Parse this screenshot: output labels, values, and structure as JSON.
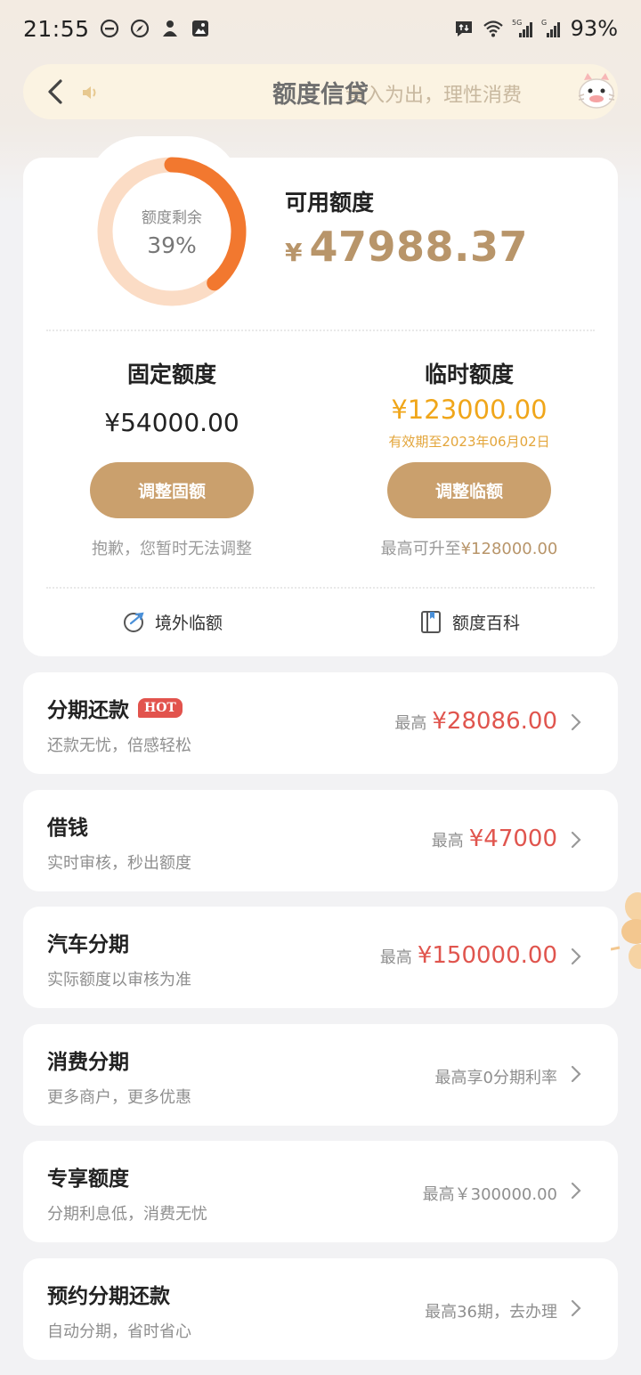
{
  "status_bar": {
    "time": "21:55",
    "battery": "93%",
    "left_icons": [
      "do-not-disturb-icon",
      "compass-icon",
      "app-icon",
      "image-icon"
    ],
    "right_icons": [
      "message-icon",
      "wifi-icon",
      "signal-5g-icon",
      "signal-g-icon"
    ]
  },
  "nav": {
    "title": "额度信贷",
    "marquee": "量入为出，理性消费",
    "back_icon": "back-arrow-icon",
    "speaker_icon": "speaker-icon",
    "mascot_icon": "mascot-icon"
  },
  "quota": {
    "ring_label": "额度剩余",
    "ring_percent_text": "39%",
    "ring_fraction": 0.39,
    "available_label": "可用额度",
    "available_currency": "¥",
    "available_amount": "47988.37",
    "fixed": {
      "title": "固定额度",
      "amount": "¥54000.00",
      "button": "调整固额",
      "note": "抱歉，您暂时无法调整"
    },
    "temp": {
      "title": "临时额度",
      "amount": "¥123000.00",
      "expiry": "有效期至2023年06月02日",
      "button": "调整临额",
      "note_prefix": "最高可升至",
      "note_value": "¥128000.00"
    },
    "links": {
      "overseas": "境外临额",
      "wiki": "额度百科"
    }
  },
  "products": [
    {
      "title": "分期还款",
      "badge": "HOT",
      "subtitle": "还款无忧，倍感轻松",
      "prefix": "最高",
      "value": "¥28086.00",
      "plain": ""
    },
    {
      "title": "借钱",
      "badge": "",
      "subtitle": "实时审核，秒出额度",
      "prefix": "最高",
      "value": "¥47000",
      "plain": ""
    },
    {
      "title": "汽车分期",
      "badge": "",
      "subtitle": "实际额度以审核为准",
      "prefix": "最高",
      "value": "¥150000.00",
      "plain": ""
    },
    {
      "title": "消费分期",
      "badge": "",
      "subtitle": "更多商户，更多优惠",
      "prefix": "",
      "value": "",
      "plain": "最高享0分期利率"
    },
    {
      "title": "专享额度",
      "badge": "",
      "subtitle": "分期利息低，消费无忧",
      "prefix": "",
      "value": "",
      "plain": "最高￥300000.00"
    },
    {
      "title": "预约分期还款",
      "badge": "",
      "subtitle": "自动分期，省时省心",
      "prefix": "",
      "value": "",
      "plain": "最高36期，去办理"
    }
  ],
  "colors": {
    "accent_gold": "#b8956a",
    "button_gold": "#caa06d",
    "ring_orange": "#f2782f",
    "ring_track": "#fbdcc5",
    "temp_amount": "#f0a61a",
    "red_value": "#e0554e",
    "hot_badge": "#e2534d"
  }
}
